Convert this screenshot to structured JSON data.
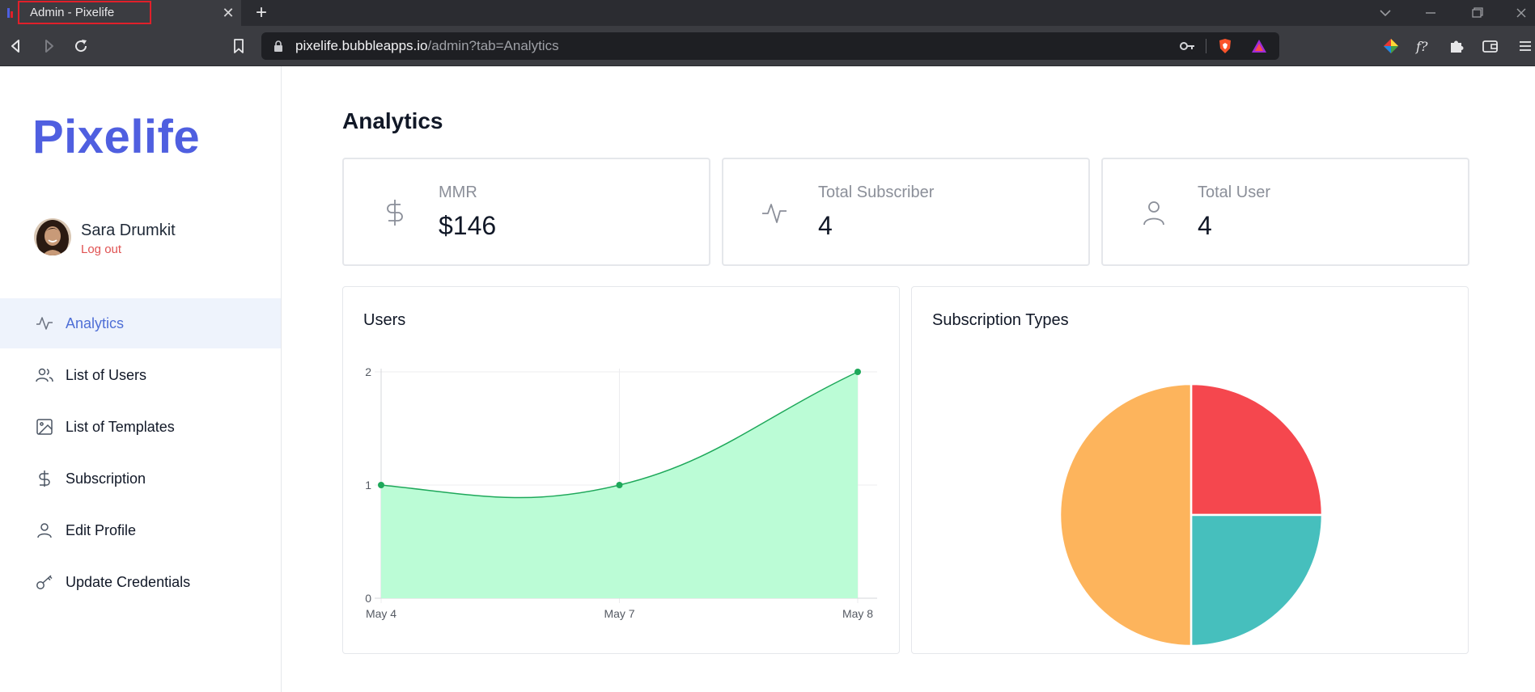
{
  "browser": {
    "tab_title": "Admin - Pixelife",
    "tab_close": "✕",
    "new_tab": "+",
    "url_host": "pixelife.bubbleapps.io",
    "url_path": "/admin?tab=Analytics"
  },
  "sidebar": {
    "logo": "Pixelife",
    "user_name": "Sara Drumkit",
    "logout": "Log out",
    "items": [
      {
        "label": "Analytics",
        "icon": "pulse-icon",
        "active": true
      },
      {
        "label": "List of Users",
        "icon": "users-icon",
        "active": false
      },
      {
        "label": "List of Templates",
        "icon": "image-icon",
        "active": false
      },
      {
        "label": "Subscription",
        "icon": "dollar-icon",
        "active": false
      },
      {
        "label": "Edit Profile",
        "icon": "user-icon",
        "active": false
      },
      {
        "label": "Update Credentials",
        "icon": "key-icon",
        "active": false
      }
    ]
  },
  "main": {
    "title": "Analytics",
    "stats": [
      {
        "label": "MMR",
        "value": "$146",
        "icon": "dollar-icon"
      },
      {
        "label": "Total Subscriber",
        "value": "4",
        "icon": "pulse-icon"
      },
      {
        "label": "Total User",
        "value": "4",
        "icon": "user-icon"
      }
    ],
    "users_chart_title": "Users",
    "subscription_chart_title": "Subscription Types"
  },
  "colors": {
    "accent": "#4f5fe0",
    "active_item_bg": "#eef3fc",
    "logout": "#e05252",
    "line": "#1ea85a",
    "area": "#bbfcd6",
    "pie_red": "#f5474e",
    "pie_teal": "#46bfbd",
    "pie_orange": "#fdb45c"
  },
  "chart_data": [
    {
      "type": "area",
      "title": "Users",
      "categories": [
        "May 4",
        "May 7",
        "May 8"
      ],
      "values": [
        1,
        1,
        2
      ],
      "ylim": [
        0,
        2
      ],
      "yticks": [
        "0",
        "1",
        "2"
      ],
      "grid": true,
      "color": "#1ea85a",
      "fill": "#bbfcd6"
    },
    {
      "type": "pie",
      "title": "Subscription Types",
      "values": [
        1,
        1,
        2
      ],
      "colors": [
        "#f5474e",
        "#46bfbd",
        "#fdb45c"
      ]
    }
  ]
}
